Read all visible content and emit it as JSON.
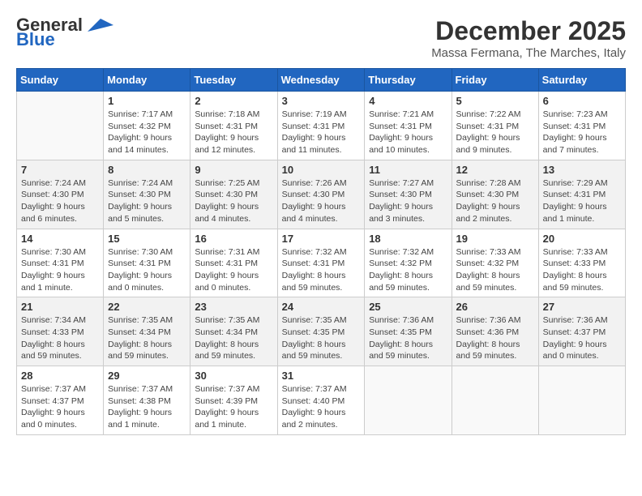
{
  "logo": {
    "general": "General",
    "blue": "Blue"
  },
  "header": {
    "month": "December 2025",
    "location": "Massa Fermana, The Marches, Italy"
  },
  "days_of_week": [
    "Sunday",
    "Monday",
    "Tuesday",
    "Wednesday",
    "Thursday",
    "Friday",
    "Saturday"
  ],
  "weeks": [
    [
      {
        "day": "",
        "info": ""
      },
      {
        "day": "1",
        "info": "Sunrise: 7:17 AM\nSunset: 4:32 PM\nDaylight: 9 hours\nand 14 minutes."
      },
      {
        "day": "2",
        "info": "Sunrise: 7:18 AM\nSunset: 4:31 PM\nDaylight: 9 hours\nand 12 minutes."
      },
      {
        "day": "3",
        "info": "Sunrise: 7:19 AM\nSunset: 4:31 PM\nDaylight: 9 hours\nand 11 minutes."
      },
      {
        "day": "4",
        "info": "Sunrise: 7:21 AM\nSunset: 4:31 PM\nDaylight: 9 hours\nand 10 minutes."
      },
      {
        "day": "5",
        "info": "Sunrise: 7:22 AM\nSunset: 4:31 PM\nDaylight: 9 hours\nand 9 minutes."
      },
      {
        "day": "6",
        "info": "Sunrise: 7:23 AM\nSunset: 4:31 PM\nDaylight: 9 hours\nand 7 minutes."
      }
    ],
    [
      {
        "day": "7",
        "info": "Sunrise: 7:24 AM\nSunset: 4:30 PM\nDaylight: 9 hours\nand 6 minutes."
      },
      {
        "day": "8",
        "info": "Sunrise: 7:24 AM\nSunset: 4:30 PM\nDaylight: 9 hours\nand 5 minutes."
      },
      {
        "day": "9",
        "info": "Sunrise: 7:25 AM\nSunset: 4:30 PM\nDaylight: 9 hours\nand 4 minutes."
      },
      {
        "day": "10",
        "info": "Sunrise: 7:26 AM\nSunset: 4:30 PM\nDaylight: 9 hours\nand 4 minutes."
      },
      {
        "day": "11",
        "info": "Sunrise: 7:27 AM\nSunset: 4:30 PM\nDaylight: 9 hours\nand 3 minutes."
      },
      {
        "day": "12",
        "info": "Sunrise: 7:28 AM\nSunset: 4:30 PM\nDaylight: 9 hours\nand 2 minutes."
      },
      {
        "day": "13",
        "info": "Sunrise: 7:29 AM\nSunset: 4:31 PM\nDaylight: 9 hours\nand 1 minute."
      }
    ],
    [
      {
        "day": "14",
        "info": "Sunrise: 7:30 AM\nSunset: 4:31 PM\nDaylight: 9 hours\nand 1 minute."
      },
      {
        "day": "15",
        "info": "Sunrise: 7:30 AM\nSunset: 4:31 PM\nDaylight: 9 hours\nand 0 minutes."
      },
      {
        "day": "16",
        "info": "Sunrise: 7:31 AM\nSunset: 4:31 PM\nDaylight: 9 hours\nand 0 minutes."
      },
      {
        "day": "17",
        "info": "Sunrise: 7:32 AM\nSunset: 4:31 PM\nDaylight: 8 hours\nand 59 minutes."
      },
      {
        "day": "18",
        "info": "Sunrise: 7:32 AM\nSunset: 4:32 PM\nDaylight: 8 hours\nand 59 minutes."
      },
      {
        "day": "19",
        "info": "Sunrise: 7:33 AM\nSunset: 4:32 PM\nDaylight: 8 hours\nand 59 minutes."
      },
      {
        "day": "20",
        "info": "Sunrise: 7:33 AM\nSunset: 4:33 PM\nDaylight: 8 hours\nand 59 minutes."
      }
    ],
    [
      {
        "day": "21",
        "info": "Sunrise: 7:34 AM\nSunset: 4:33 PM\nDaylight: 8 hours\nand 59 minutes."
      },
      {
        "day": "22",
        "info": "Sunrise: 7:35 AM\nSunset: 4:34 PM\nDaylight: 8 hours\nand 59 minutes."
      },
      {
        "day": "23",
        "info": "Sunrise: 7:35 AM\nSunset: 4:34 PM\nDaylight: 8 hours\nand 59 minutes."
      },
      {
        "day": "24",
        "info": "Sunrise: 7:35 AM\nSunset: 4:35 PM\nDaylight: 8 hours\nand 59 minutes."
      },
      {
        "day": "25",
        "info": "Sunrise: 7:36 AM\nSunset: 4:35 PM\nDaylight: 8 hours\nand 59 minutes."
      },
      {
        "day": "26",
        "info": "Sunrise: 7:36 AM\nSunset: 4:36 PM\nDaylight: 8 hours\nand 59 minutes."
      },
      {
        "day": "27",
        "info": "Sunrise: 7:36 AM\nSunset: 4:37 PM\nDaylight: 9 hours\nand 0 minutes."
      }
    ],
    [
      {
        "day": "28",
        "info": "Sunrise: 7:37 AM\nSunset: 4:37 PM\nDaylight: 9 hours\nand 0 minutes."
      },
      {
        "day": "29",
        "info": "Sunrise: 7:37 AM\nSunset: 4:38 PM\nDaylight: 9 hours\nand 1 minute."
      },
      {
        "day": "30",
        "info": "Sunrise: 7:37 AM\nSunset: 4:39 PM\nDaylight: 9 hours\nand 1 minute."
      },
      {
        "day": "31",
        "info": "Sunrise: 7:37 AM\nSunset: 4:40 PM\nDaylight: 9 hours\nand 2 minutes."
      },
      {
        "day": "",
        "info": ""
      },
      {
        "day": "",
        "info": ""
      },
      {
        "day": "",
        "info": ""
      }
    ]
  ]
}
